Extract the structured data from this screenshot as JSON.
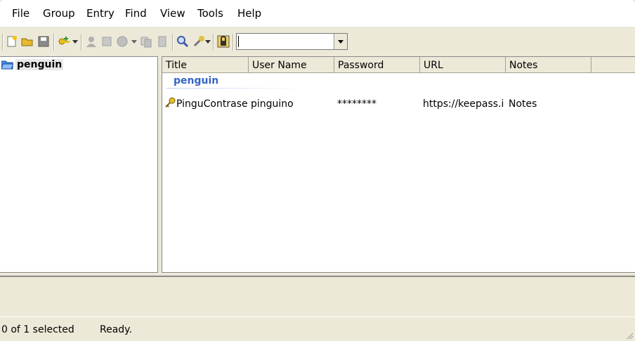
{
  "menu": [
    "File",
    "Group",
    "Entry",
    "Find",
    "View",
    "Tools",
    "Help"
  ],
  "toolbar": {
    "search_value": "",
    "icons": [
      "new-database-icon",
      "open-database-icon",
      "save-database-icon",
      "add-entry-icon",
      "copy-username-icon",
      "copy-password-icon",
      "open-url-icon",
      "copy-entry-icon",
      "delete-entry-icon",
      "find-icon",
      "tools-icon",
      "lock-workspace-icon"
    ]
  },
  "tree": {
    "root_label": "penguin"
  },
  "list": {
    "columns": [
      "Title",
      "User Name",
      "Password",
      "URL",
      "Notes"
    ],
    "group_header": "penguin",
    "rows": [
      {
        "title": "PinguContraseñ",
        "username": "pinguino",
        "password": "********",
        "url": "https://keepass.in",
        "notes": "Notes"
      }
    ]
  },
  "status": {
    "selection": "0 of 1 selected",
    "state": "Ready."
  }
}
